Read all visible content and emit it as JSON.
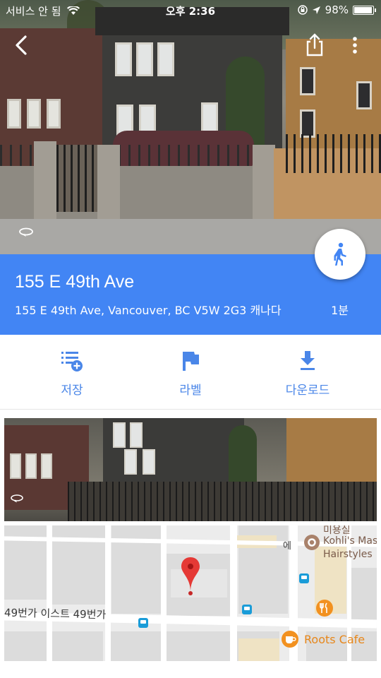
{
  "status_bar": {
    "carrier": "서비스 안 됨",
    "time": "오후 2:36",
    "battery": "98%",
    "battery_level": 0.98
  },
  "place": {
    "title": "155 E 49th Ave",
    "address": "155 E 49th Ave, Vancouver, BC V5W 2G3 캐나다",
    "walk_time": "1분"
  },
  "actions": {
    "save_label": "저장",
    "label_label": "라벨",
    "download_label": "다운로드"
  },
  "map": {
    "street_label": "49번가 이스트 49번가",
    "poi_name_line1": "Kohli's Mas",
    "poi_name_line2": "Hairstyles",
    "poi_category": "미용실",
    "cafe_name": "Roots Cafe",
    "vertical_street": "에"
  },
  "colors": {
    "accent": "#4285f4",
    "action_blue": "#4a86e8",
    "pin_red": "#e53935",
    "cafe_orange": "#f29120"
  }
}
